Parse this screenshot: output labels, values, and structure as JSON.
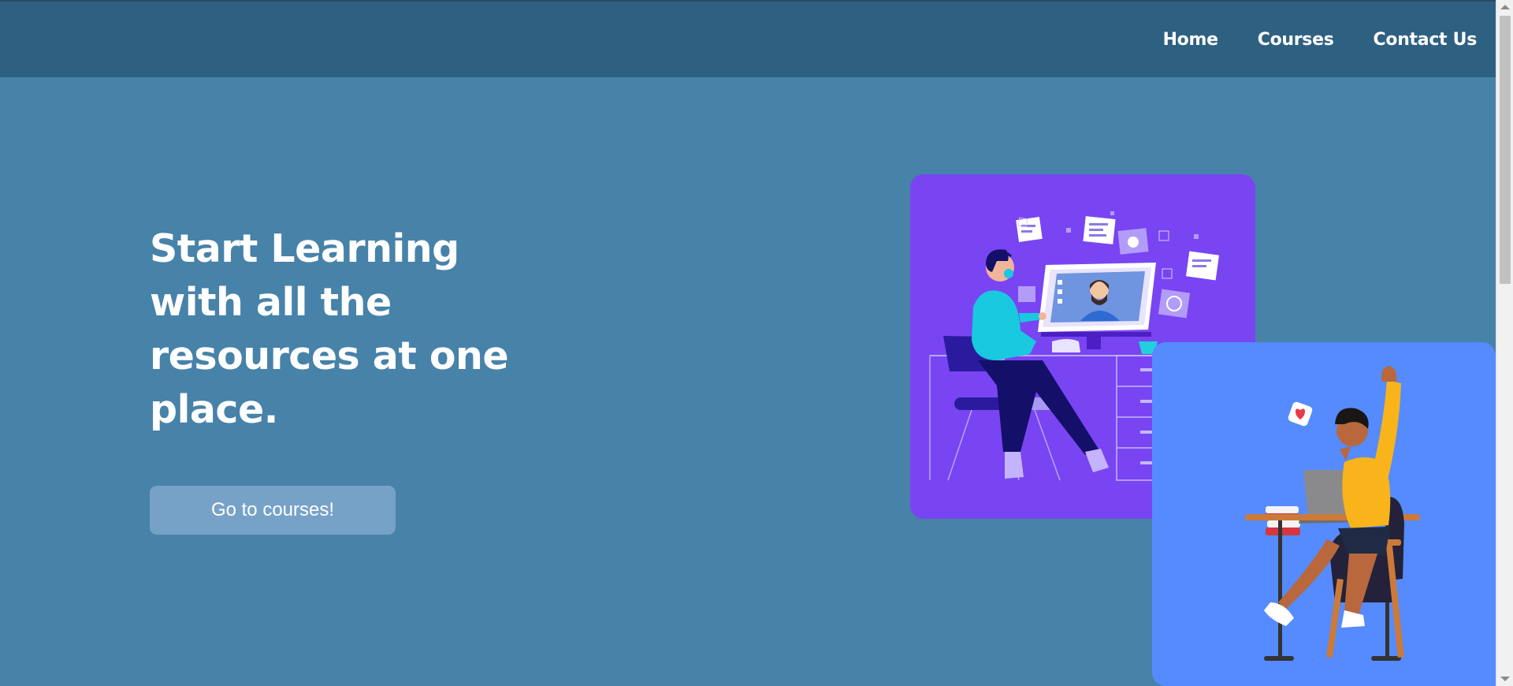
{
  "nav": {
    "items": [
      {
        "label": "Home"
      },
      {
        "label": "Courses"
      },
      {
        "label": "Contact Us"
      }
    ]
  },
  "hero": {
    "title": "Start Learning with all the resources at one place.",
    "cta_label": "Go to courses!"
  },
  "colors": {
    "page_background": "#4782a9",
    "navbar_background": "#2e6082",
    "button_background": "#77a2c8",
    "card_purple": "#7945f2",
    "card_blue": "#558bfe"
  }
}
